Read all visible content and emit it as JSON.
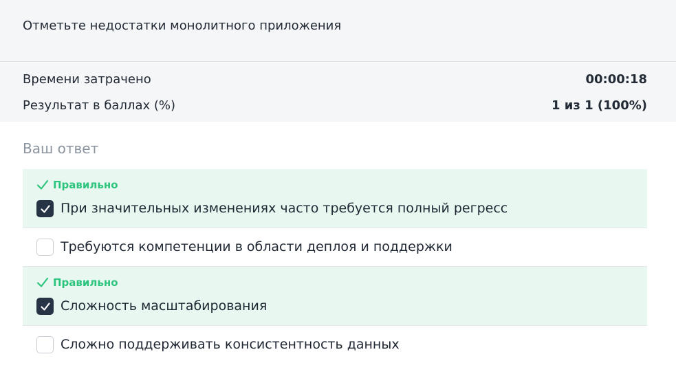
{
  "question": {
    "text": "Отметьте недостатки монолитного приложения"
  },
  "stats": {
    "time_label": "Времени затрачено",
    "time_value": "00:00:18",
    "score_label": "Результат в баллах (%)",
    "score_value": "1 из 1 (100%)"
  },
  "answer": {
    "heading": "Ваш ответ",
    "correct_label": "Правильно",
    "options": [
      {
        "text": "При значительных изменениях часто требуется полный регресс",
        "checked": true,
        "correct": true
      },
      {
        "text": "Требуются компетенции в области деплоя и поддержки",
        "checked": false,
        "correct": false
      },
      {
        "text": "Сложность масштабирования",
        "checked": true,
        "correct": true
      },
      {
        "text": "Сложно поддерживать консистентность данных",
        "checked": false,
        "correct": false
      }
    ]
  },
  "colors": {
    "correct_bg": "#e8f7f0",
    "correct_text": "#2ec47e",
    "checkbox_checked": "#263445"
  },
  "icons": {
    "correct": "check-icon",
    "checked_box": "checkbox-checked-icon",
    "empty_box": "checkbox-empty-icon"
  }
}
